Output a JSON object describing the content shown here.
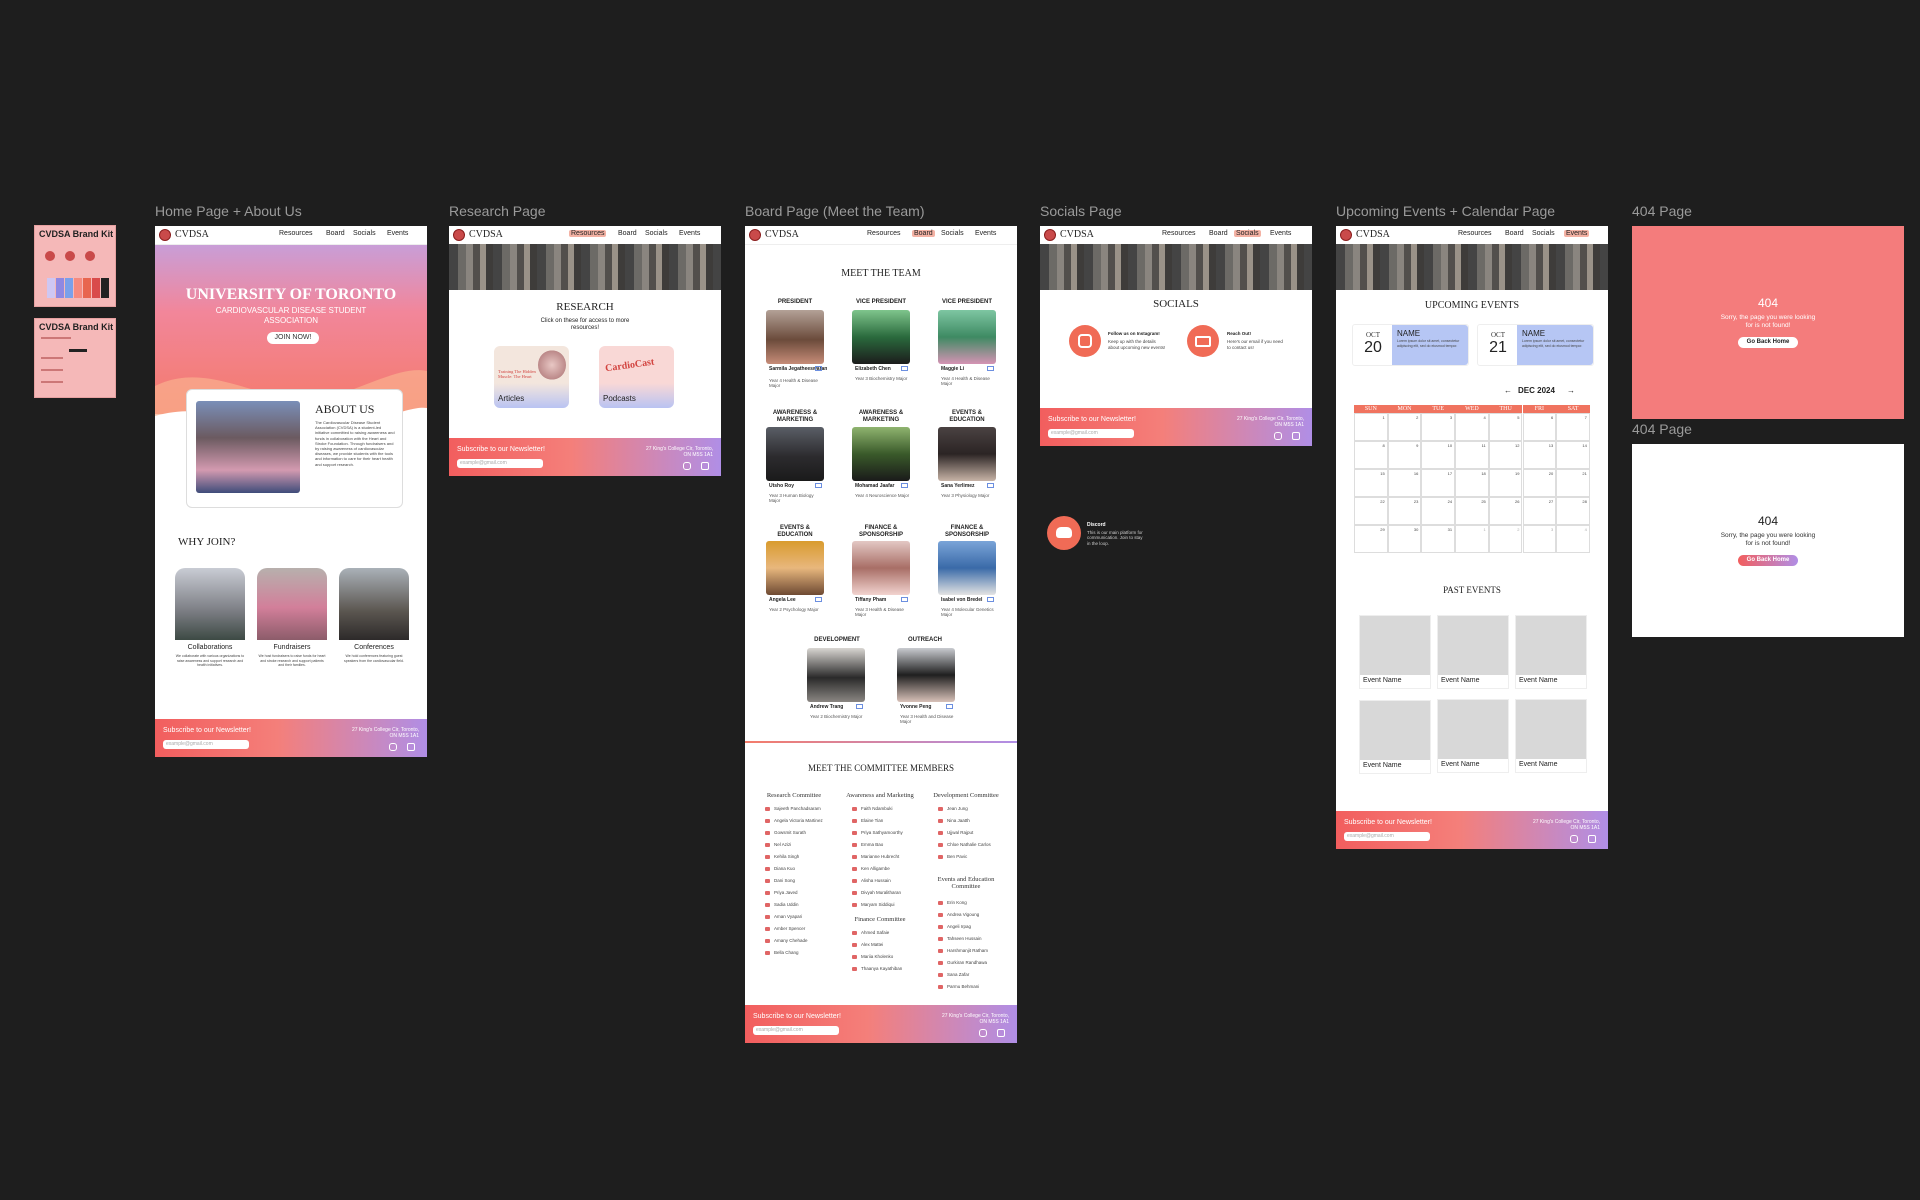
{
  "brand_kit": [
    "CVDSA Brand Kit",
    "CVDSA Brand Kit"
  ],
  "frames": {
    "home": "Home Page + About Us",
    "research": "Research Page",
    "board": "Board Page (Meet the Team)",
    "socials": "Socials Page",
    "events": "Upcoming Events + Calendar Page",
    "e404a": "404 Page",
    "e404b": "404 Page"
  },
  "nav": {
    "brand": "CVDSA",
    "items": [
      "Resources",
      "Board",
      "Socials",
      "Events"
    ]
  },
  "footer": {
    "title": "Subscribe to our Newsletter!",
    "placeholder": "example@gmail.com",
    "address": "27 King's College Cir, Toronto, ON M5S 1A1"
  },
  "home": {
    "title": "UNIVERSITY OF TORONTO",
    "subtitle": "CARDIOVASCULAR DISEASE STUDENT ASSOCIATION",
    "join": "JOIN NOW!",
    "about_title": "ABOUT US",
    "about_text": "The Cardiovascular Disease Student Association (CVDSA) is a student-led initiative committed to raising awareness and funds in collaboration with the Heart and Stroke Foundation. Through fundraisers and by raising awareness of cardiovascular diseases, we provide students with the tools and information to care for their heart health and support research.",
    "why_title": "WHY JOIN?",
    "why": [
      {
        "label": "Collaborations",
        "text": "We collaborate with various organizations to raise awareness and support research and health initiatives."
      },
      {
        "label": "Fundraisers",
        "text": "We host fundraisers to raise funds for heart and stroke research and support patients and their families."
      },
      {
        "label": "Conferences",
        "text": "We hold conferences featuring guest speakers from the cardiovascular field."
      }
    ]
  },
  "research": {
    "title": "RESEARCH",
    "sub": "Click on these for access to more resources!",
    "cards": [
      {
        "label": "Articles",
        "art": "Training The Hidden Muscle: The Heart"
      },
      {
        "label": "Podcasts",
        "art": "CardioCast"
      }
    ]
  },
  "board": {
    "title": "MEET THE TEAM",
    "members": [
      {
        "role": "PRESIDENT",
        "name": "Sarmila Jegatheeswaran",
        "info": "Year 4 Health & Disease Major"
      },
      {
        "role": "VICE PRESIDENT",
        "name": "Elizabeth Chen",
        "info": "Year 3 Biochemistry Major"
      },
      {
        "role": "VICE PRESIDENT",
        "name": "Maggie Li",
        "info": "Year 4 Health & Disease Major"
      },
      {
        "role": "AWARENESS & MARKETING",
        "name": "Utsho Roy",
        "info": "Year 3 Human Biology Major"
      },
      {
        "role": "AWARENESS & MARKETING",
        "name": "Mohamad Jaafar",
        "info": "Year 4 Neuroscience Major"
      },
      {
        "role": "EVENTS & EDUCATION",
        "name": "Sana Yerlimez",
        "info": "Year 3 Physiology Major"
      },
      {
        "role": "EVENTS & EDUCATION",
        "name": "Angela Lee",
        "info": "Year 2 Psychology Major"
      },
      {
        "role": "FINANCE & SPONSORSHIP",
        "name": "Tiffany Pham",
        "info": "Year 3 Health & Disease Major"
      },
      {
        "role": "FINANCE & SPONSORSHIP",
        "name": "Isabel von Bredel",
        "info": "Year 4 Molecular Genetics Major"
      },
      {
        "role": "DEVELOPMENT",
        "name": "Andrew Trang",
        "info": "Year 2 Biochemistry Major"
      },
      {
        "role": "OUTREACH",
        "name": "Yvonne Peng",
        "info": "Year 3 Health and Disease Major"
      }
    ],
    "committee_title": "MEET THE COMMITTEE MEMBERS",
    "committees": [
      {
        "name": "Research Committee",
        "members": [
          "Sajeeth Panchadsaram",
          "Angela Victoria Martinez",
          "Gowsmit Surath",
          "Nel Azizi",
          "Kehila Singh",
          "Diana Kuo",
          "Dani Song",
          "Priya Javed",
          "Sadia Uddin",
          "Aman Vyapari",
          "Amber Spencer",
          "Amany Chehade",
          "Bella Chang"
        ]
      },
      {
        "name": "Awareness and Marketing",
        "members": [
          "Faith Ndambuki",
          "Elaine Tian",
          "Priya Sathyamoorthy",
          "Emma Bao",
          "Marianne Hubrecht",
          "Ken Alligambe",
          "Alisha Hussain",
          "Divyah Muralitharan",
          "Maryam Siddiqui"
        ]
      },
      {
        "name": "Finance Committee",
        "members": [
          "Ahmed Safaie",
          "Alex Mattei",
          "Mariia Kholenko",
          "Thaanya Kayathiban"
        ]
      },
      {
        "name": "Development Committee",
        "members": [
          "Jean Jung",
          "Nina Jaatth",
          "Ujjwal Rajput",
          "Chloe Nathalie Carlos",
          "Ben Pavic"
        ]
      },
      {
        "name": "Events and Education Committee",
        "members": [
          "Erin Kong",
          "Andrea Vigoung",
          "Angeli Irpag",
          "Tahseen Hussain",
          "Harshmanjit Ratham",
          "Gurkiran Randhawa",
          "Sana Zafar",
          "Parmu Behmani"
        ]
      }
    ]
  },
  "socials": {
    "title": "SOCIALS",
    "items": [
      {
        "title": "Follow us on Instagram!",
        "text": "Keep up with the details about upcoming new events!"
      },
      {
        "title": "Reach Out!",
        "text": "Here's our email if you need to contact us!"
      }
    ],
    "discord_title": "Discord",
    "discord_text": "This is our main platform for communication. Join to stay in the loop."
  },
  "events": {
    "title": "UPCOMING EVENTS",
    "upcoming": [
      {
        "month": "OCT",
        "day": "20",
        "name": "NAME",
        "desc": "Lorem ipsum dolor sit amet, consectetur adipiscing elit, sed do eiusmod tempor."
      },
      {
        "month": "OCT",
        "day": "21",
        "name": "NAME",
        "desc": "Lorem ipsum dolor sit amet, consectetur adipiscing elit, sed do eiusmod tempor."
      }
    ],
    "calendar_month": "DEC 2024",
    "prev": "←",
    "next": "→",
    "weekdays": [
      "SUN",
      "MON",
      "TUE",
      "WED",
      "THU",
      "FRI",
      "SAT"
    ],
    "days": [
      "1",
      "2",
      "3",
      "4",
      "5",
      "6",
      "7",
      "8",
      "9",
      "10",
      "11",
      "12",
      "13",
      "14",
      "15",
      "16",
      "17",
      "18",
      "19",
      "20",
      "21",
      "22",
      "23",
      "24",
      "25",
      "26",
      "27",
      "28",
      "29",
      "30",
      "31",
      "1",
      "2",
      "3",
      "4"
    ],
    "past_title": "PAST EVENTS",
    "past": [
      "Event Name",
      "Event Name",
      "Event Name",
      "Event Name",
      "Event Name",
      "Event Name"
    ]
  },
  "e404": {
    "code": "404",
    "msg": "Sorry, the page you were looking for is not found!",
    "btn": "Go Back Home"
  },
  "colors": {
    "coral": "#f0735f",
    "pink": "#f47f7a",
    "purple": "#b08ee6",
    "salmon": "#f47c7c"
  }
}
